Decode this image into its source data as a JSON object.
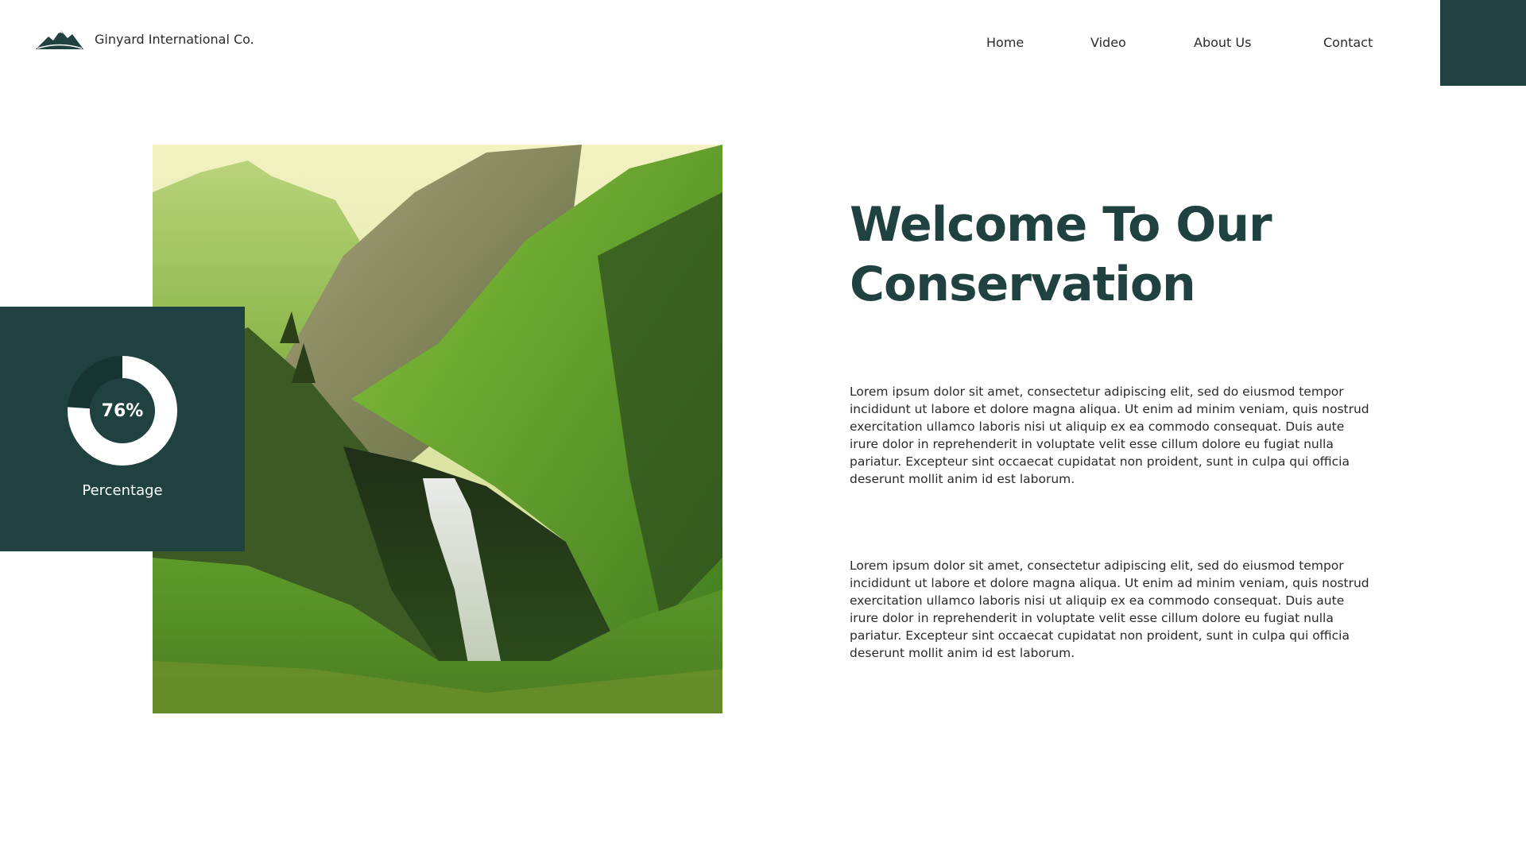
{
  "brand": {
    "name": "Ginyard International Co.",
    "logo_icon": "mountain-icon"
  },
  "nav": {
    "items": [
      "Home",
      "Video",
      "About Us",
      "Contact"
    ]
  },
  "colors": {
    "accent": "#1f413f",
    "accent_dark": "#163432",
    "white": "#ffffff"
  },
  "stat": {
    "value": 76,
    "value_label": "76%",
    "label": "Percentage"
  },
  "hero": {
    "headline_line1": "Welcome To Our",
    "headline_line2": "Conservation",
    "image_icon": "mountain-waterfall-photo"
  },
  "paragraphs": [
    "Lorem ipsum dolor sit amet, consectetur adipiscing elit, sed do eiusmod tempor incididunt ut labore et dolore magna aliqua. Ut enim ad minim veniam, quis nostrud exercitation ullamco laboris nisi ut aliquip ex ea commodo consequat. Duis aute irure dolor in reprehenderit in voluptate velit esse cillum dolore eu fugiat nulla pariatur. Excepteur sint occaecat cupidatat non proident, sunt in culpa qui officia deserunt mollit anim id est laborum.",
    "Lorem ipsum dolor sit amet, consectetur adipiscing elit, sed do eiusmod tempor incididunt ut labore et dolore magna aliqua. Ut enim ad minim veniam, quis nostrud exercitation ullamco laboris nisi ut aliquip ex ea commodo consequat. Duis aute irure dolor in reprehenderit in voluptate velit esse cillum dolore eu fugiat nulla pariatur. Excepteur sint occaecat cupidatat non proident, sunt in culpa qui officia deserunt mollit anim id est laborum."
  ]
}
